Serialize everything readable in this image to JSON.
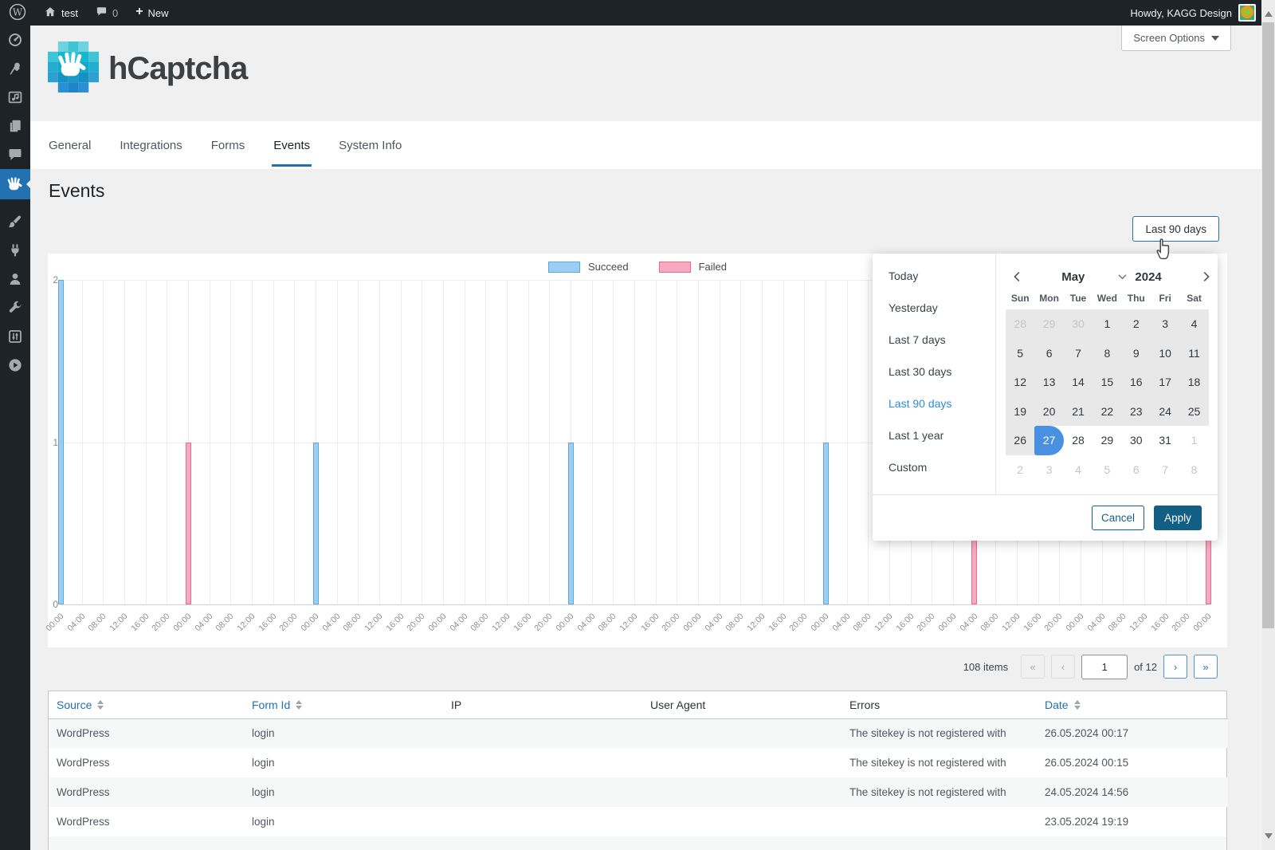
{
  "colors": {
    "admin_dark": "#1d2327",
    "accent": "#2271b1",
    "preset_active": "#2b8fd4",
    "selected_day": "#4a90e2",
    "apply_button": "#135e83",
    "succeed_fill": "#9dcef2",
    "succeed_border": "#54a9e8",
    "failed_fill": "#f7aabf",
    "failed_border": "#ef678f"
  },
  "admin_bar": {
    "site_label": "test",
    "comments_count": "0",
    "new_label": "New",
    "howdy_label": "Howdy, KAGG Design"
  },
  "screen_options": {
    "label": "Screen Options"
  },
  "branding": {
    "logo_text": "hCaptcha"
  },
  "tabs": {
    "items": [
      "General",
      "Integrations",
      "Forms",
      "Events",
      "System Info"
    ],
    "active_index": 3
  },
  "page_title": "Events",
  "range_button_label": "Last 90 days",
  "datepicker": {
    "presets": [
      "Today",
      "Yesterday",
      "Last 7 days",
      "Last 30 days",
      "Last 90 days",
      "Last 1 year",
      "Custom"
    ],
    "selected_preset_index": 4,
    "month": "May",
    "year": "2024",
    "weekdays": [
      "Sun",
      "Mon",
      "Tue",
      "Wed",
      "Thu",
      "Fri",
      "Sat"
    ],
    "weeks": [
      [
        {
          "d": 28,
          "m": 1,
          "r": 1
        },
        {
          "d": 29,
          "m": 1,
          "r": 1
        },
        {
          "d": 30,
          "m": 1,
          "r": 1
        },
        {
          "d": 1,
          "r": 1
        },
        {
          "d": 2,
          "r": 1
        },
        {
          "d": 3,
          "r": 1
        },
        {
          "d": 4,
          "r": 1
        }
      ],
      [
        {
          "d": 5,
          "r": 1
        },
        {
          "d": 6,
          "r": 1
        },
        {
          "d": 7,
          "r": 1
        },
        {
          "d": 8,
          "r": 1
        },
        {
          "d": 9,
          "r": 1
        },
        {
          "d": 10,
          "r": 1
        },
        {
          "d": 11,
          "r": 1
        }
      ],
      [
        {
          "d": 12,
          "r": 1
        },
        {
          "d": 13,
          "r": 1
        },
        {
          "d": 14,
          "r": 1
        },
        {
          "d": 15,
          "r": 1
        },
        {
          "d": 16,
          "r": 1
        },
        {
          "d": 17,
          "r": 1
        },
        {
          "d": 18,
          "r": 1
        }
      ],
      [
        {
          "d": 19,
          "r": 1
        },
        {
          "d": 20,
          "r": 1
        },
        {
          "d": 21,
          "r": 1
        },
        {
          "d": 22,
          "r": 1
        },
        {
          "d": 23,
          "r": 1
        },
        {
          "d": 24,
          "r": 1
        },
        {
          "d": 25,
          "r": 1
        }
      ],
      [
        {
          "d": 26,
          "r": 1
        },
        {
          "d": 27,
          "s": 1
        },
        {
          "d": 28
        },
        {
          "d": 29
        },
        {
          "d": 30
        },
        {
          "d": 31
        },
        {
          "d": 1,
          "m": 1
        }
      ],
      [
        {
          "d": 2,
          "m": 1
        },
        {
          "d": 3,
          "m": 1
        },
        {
          "d": 4,
          "m": 1
        },
        {
          "d": 5,
          "m": 1
        },
        {
          "d": 6,
          "m": 1
        },
        {
          "d": 7,
          "m": 1
        },
        {
          "d": 8,
          "m": 1
        }
      ]
    ],
    "cancel_label": "Cancel",
    "apply_label": "Apply"
  },
  "chart_data": {
    "type": "bar",
    "title": "",
    "ylim": [
      0,
      2
    ],
    "yticks": [
      0,
      1,
      2
    ],
    "grid": true,
    "legend_position": "top-center",
    "x_labels": [
      "00:00",
      "04:00",
      "08:00",
      "12:00",
      "16:00",
      "20:00",
      "00:00",
      "04:00",
      "08:00",
      "12:00",
      "16:00",
      "20:00",
      "00:00",
      "04:00",
      "08:00",
      "12:00",
      "16:00",
      "20:00",
      "00:00",
      "04:00",
      "08:00",
      "12:00",
      "16:00",
      "20:00",
      "00:00",
      "04:00",
      "08:00",
      "12:00",
      "16:00",
      "20:00",
      "00:00",
      "04:00",
      "08:00",
      "12:00",
      "16:00",
      "20:00",
      "00:00",
      "04:00",
      "08:00",
      "12:00",
      "16:00",
      "20:00",
      "00:00",
      "04:00",
      "08:00",
      "12:00",
      "16:00",
      "20:00",
      "00:00",
      "04:00",
      "08:00",
      "12:00",
      "16:00",
      "20:00",
      "00:00"
    ],
    "series": [
      {
        "name": "Succeed",
        "color": "#9dcef2",
        "border": "#54a9e8",
        "points": [
          [
            0,
            2
          ],
          [
            12,
            1
          ],
          [
            24,
            1
          ],
          [
            36,
            1
          ]
        ]
      },
      {
        "name": "Failed",
        "color": "#f7aabf",
        "border": "#ef678f",
        "points": [
          [
            6,
            1
          ],
          [
            43,
            1
          ],
          [
            54,
            1
          ]
        ]
      }
    ]
  },
  "pagination": {
    "items_label": "108 items",
    "first": "«",
    "prev": "‹",
    "page_value": "1",
    "of_label": "of 12",
    "next": "›",
    "last": "»"
  },
  "table": {
    "headers": [
      {
        "label": "Source",
        "sortable": true
      },
      {
        "label": "Form Id",
        "sortable": true
      },
      {
        "label": "IP",
        "sortable": false
      },
      {
        "label": "User Agent",
        "sortable": false
      },
      {
        "label": "Errors",
        "sortable": false
      },
      {
        "label": "Date",
        "sortable": true
      }
    ],
    "rows": [
      [
        "WordPress",
        "login",
        "",
        "",
        "The sitekey is not registered with",
        "26.05.2024 00:17"
      ],
      [
        "WordPress",
        "login",
        "",
        "",
        "The sitekey is not registered with",
        "26.05.2024 00:15"
      ],
      [
        "WordPress",
        "login",
        "",
        "",
        "The sitekey is not registered with",
        "24.05.2024 14:56"
      ],
      [
        "WordPress",
        "login",
        "",
        "",
        "",
        "23.05.2024 19:19"
      ]
    ]
  },
  "sidebar": {
    "items": [
      {
        "icon": "dashboard-icon"
      },
      {
        "icon": "pin-icon"
      },
      {
        "icon": "media-icon"
      },
      {
        "icon": "pages-icon"
      },
      {
        "icon": "comments-icon"
      },
      {
        "icon": "hcaptcha-hand-icon",
        "active": true
      },
      {
        "icon": "brush-icon"
      },
      {
        "icon": "plug-icon"
      },
      {
        "icon": "users-icon"
      },
      {
        "icon": "wrench-icon"
      },
      {
        "icon": "sliders-icon"
      },
      {
        "icon": "play-icon"
      }
    ]
  }
}
